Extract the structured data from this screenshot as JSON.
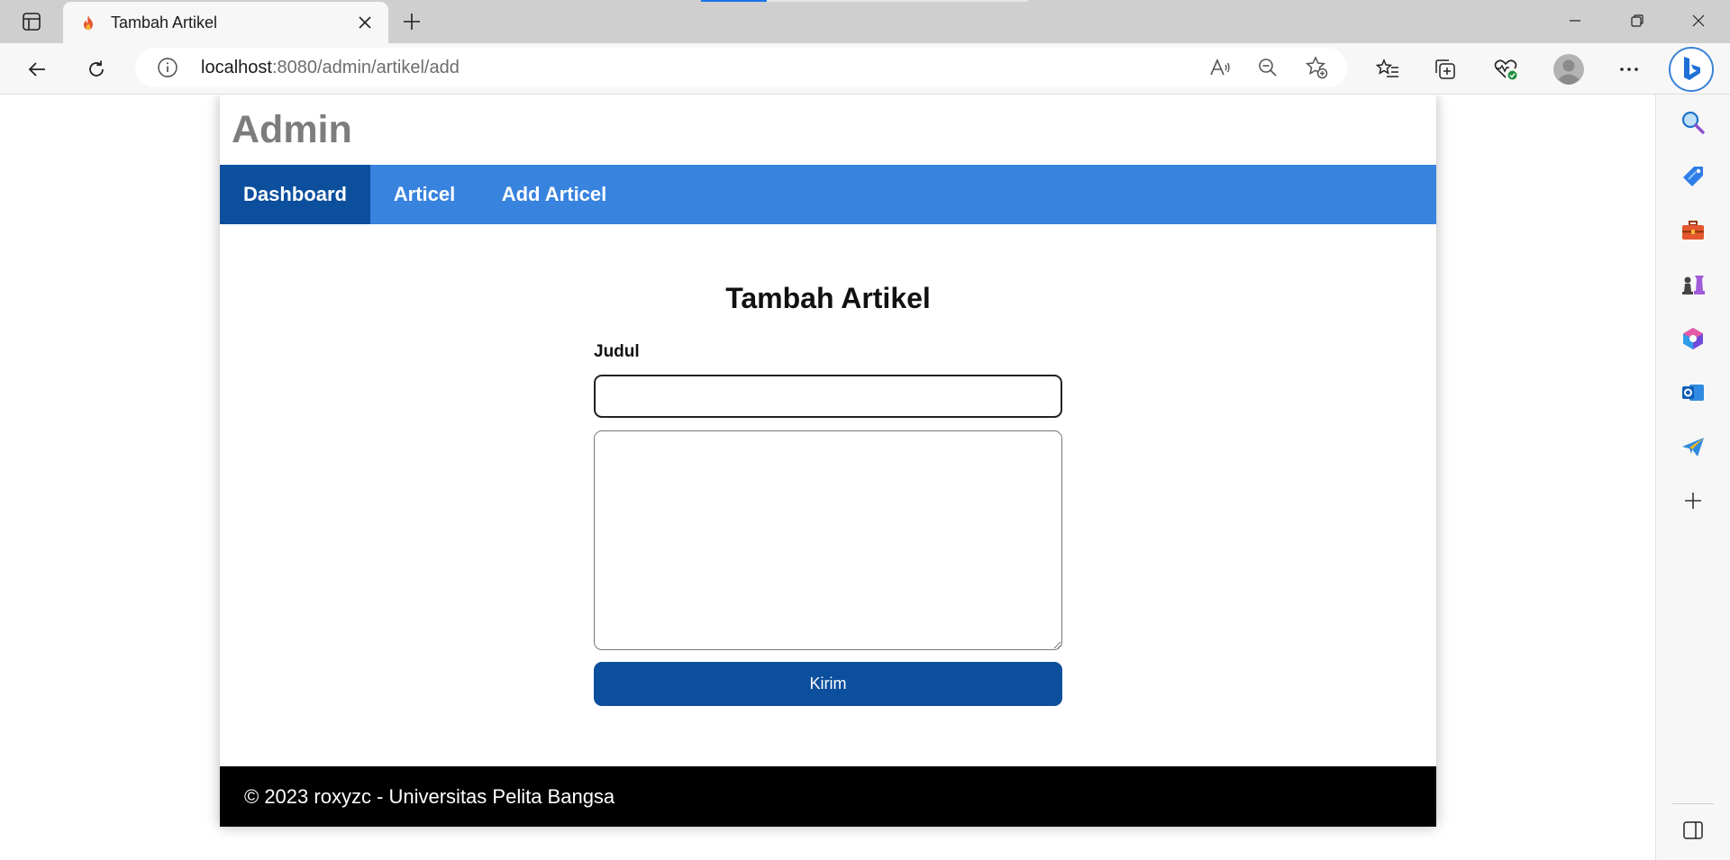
{
  "browser": {
    "tab": {
      "title": "Tambah Artikel",
      "favicon": "flame-icon"
    },
    "url": {
      "host": "localhost",
      "path": ":8080/admin/artikel/add"
    },
    "accent": "#1a73e8"
  },
  "page": {
    "site_title": "Admin",
    "nav": [
      {
        "label": "Dashboard",
        "active": true
      },
      {
        "label": "Articel",
        "active": false
      },
      {
        "label": "Add Articel",
        "active": false
      }
    ],
    "form": {
      "title": "Tambah Artikel",
      "title_label": "Judul",
      "title_value": "",
      "content_value": "",
      "submit_label": "Kirim"
    },
    "footer": "© 2023 roxyzc - Universitas Pelita Bangsa"
  },
  "colors": {
    "nav_bg": "#3883de",
    "nav_active": "#0c4f9d",
    "button": "#0c4f9d",
    "footer_bg": "#000000",
    "site_title": "#7d7d7d"
  },
  "sidebar_icons": [
    "search-icon",
    "tag-icon",
    "toolbox-icon",
    "chess-icon",
    "office-icon",
    "outlook-icon",
    "send-icon",
    "add-icon"
  ]
}
